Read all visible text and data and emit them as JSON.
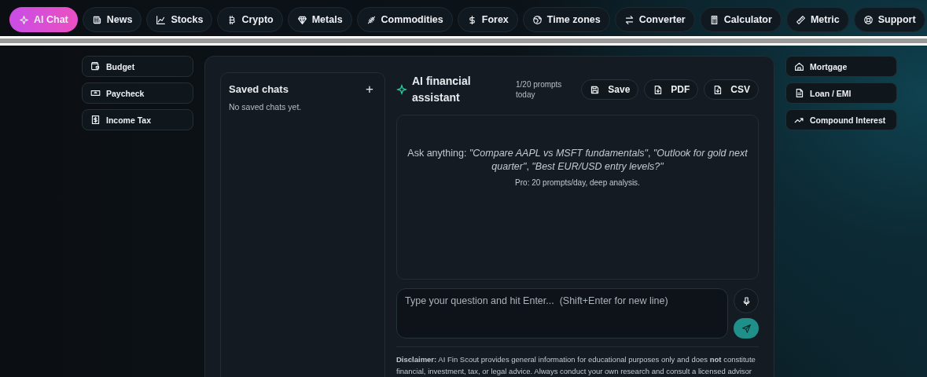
{
  "nav": {
    "tabs": [
      {
        "label": "AI Chat",
        "selected": true
      },
      {
        "label": "News",
        "selected": false
      },
      {
        "label": "Stocks",
        "selected": false
      },
      {
        "label": "Crypto",
        "selected": false
      },
      {
        "label": "Metals",
        "selected": false
      },
      {
        "label": "Commodities",
        "selected": false
      },
      {
        "label": "Forex",
        "selected": false
      },
      {
        "label": "Time zones",
        "selected": false
      },
      {
        "label": "Converter",
        "selected": false
      },
      {
        "label": "Calculator",
        "selected": false
      },
      {
        "label": "Metric",
        "selected": false
      },
      {
        "label": "Support",
        "selected": false
      }
    ]
  },
  "left_sidebar": {
    "items": [
      {
        "label": "Budget"
      },
      {
        "label": "Paycheck"
      },
      {
        "label": "Income Tax"
      }
    ]
  },
  "saved_chats": {
    "title": "Saved chats",
    "add_button": "+",
    "empty_text": "No saved chats yet."
  },
  "chat": {
    "title": "AI financial assistant",
    "usage": "1/20 prompts today",
    "actions": [
      {
        "label": "Save"
      },
      {
        "label": "PDF"
      },
      {
        "label": "CSV"
      }
    ],
    "intro": "Ask anything: *\"Compare AAPL vs MSFT fundamentals\"*, *\"Outlook for gold next quarter\"*, *\"Best EUR/USD entry levels?\"*",
    "intro_note": "Pro: 20 prompts/day, deep analysis.",
    "input": {
      "placeholder": "Type your question and hit Enter...  (Shift+Enter for new line)"
    },
    "disclaimer": "**Disclaimer:** AI Fin Scout provides general information for educational purposes only and does **not** constitute financial, investment, tax, or legal advice. Always conduct your own research and consult a licensed advisor"
  },
  "right_sidebar": {
    "items": [
      {
        "label": "Mortgage"
      },
      {
        "label": "Loan / EMI"
      },
      {
        "label": "Compound Interest"
      }
    ]
  }
}
